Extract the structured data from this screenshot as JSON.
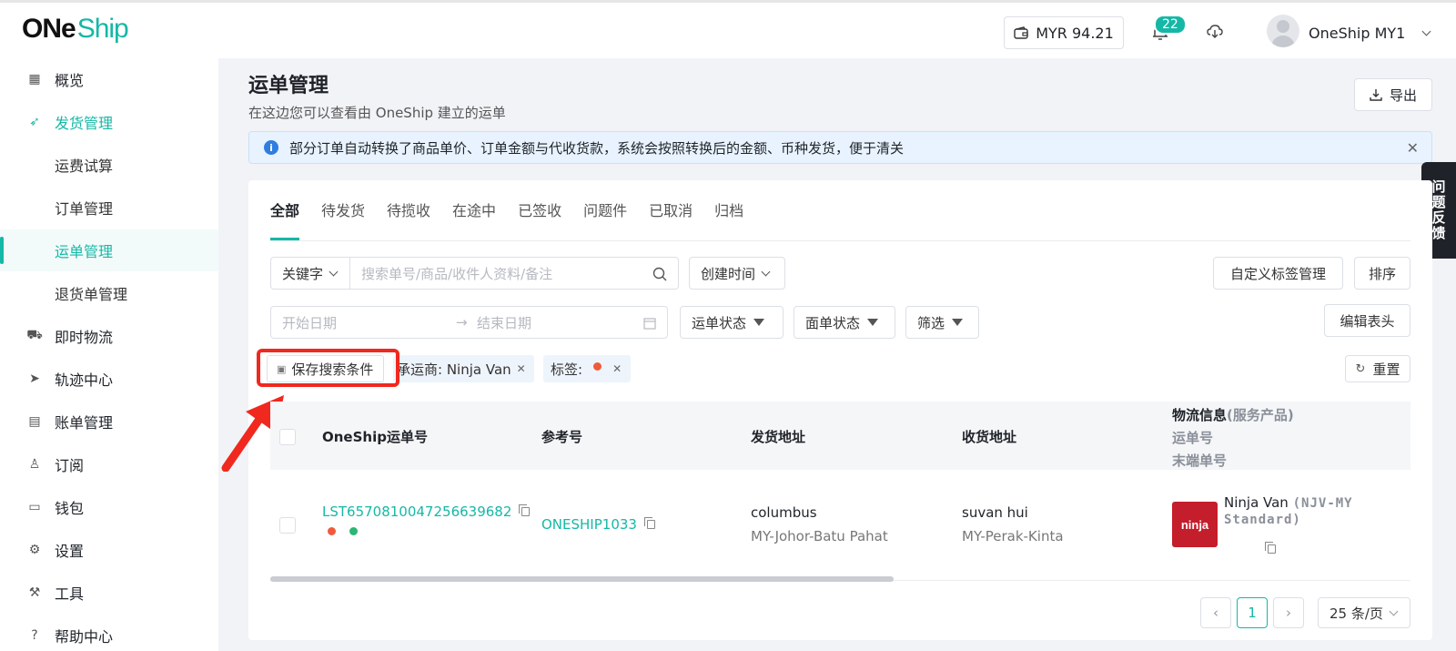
{
  "header": {
    "logo_one": "ONe",
    "logo_ship": "Ship",
    "wallet_balance": "MYR 94.21",
    "notification_count": "22",
    "user_name": "OneShip MY1"
  },
  "sidebar": {
    "items": [
      {
        "label": "概览",
        "icon": "grid-icon"
      },
      {
        "label": "发货管理",
        "icon": "rocket-icon"
      },
      {
        "label": "运费试算"
      },
      {
        "label": "订单管理"
      },
      {
        "label": "运单管理"
      },
      {
        "label": "退货单管理"
      },
      {
        "label": "即时物流",
        "icon": "scooter-icon"
      },
      {
        "label": "轨迹中心",
        "icon": "send-icon"
      },
      {
        "label": "账单管理",
        "icon": "document-icon"
      },
      {
        "label": "订阅",
        "icon": "user-icon"
      },
      {
        "label": "钱包",
        "icon": "wallet-icon"
      },
      {
        "label": "设置",
        "icon": "gear-icon"
      },
      {
        "label": "工具",
        "icon": "tool-icon"
      },
      {
        "label": "帮助中心",
        "icon": "help-icon"
      }
    ]
  },
  "page": {
    "title": "运单管理",
    "subtitle": "在这边您可以查看由 OneShip 建立的运单",
    "export_label": "导出",
    "notice": "部分订单自动转换了商品单价、订单金额与代收货款，系统会按照转换后的金额、币种发货，便于清关",
    "feedback": "问题反馈"
  },
  "tabs": [
    "全部",
    "待发货",
    "待揽收",
    "在途中",
    "已签收",
    "问题件",
    "已取消",
    "归档"
  ],
  "filters": {
    "keyword_select": "关键字",
    "search_placeholder": "搜索单号/商品/收件人资料/备注",
    "time_select": "创建时间",
    "custom_tag_btn": "自定义标签管理",
    "sort_btn": "排序",
    "start_date": "开始日期",
    "end_date": "结束日期",
    "waybill_status": "运单状态",
    "label_status": "面单状态",
    "filter": "筛选",
    "edit_header": "编辑表头",
    "save_search": "保存搜索条件",
    "carrier_tag": "承运商: Ninja Van",
    "label_tag": "标签:",
    "reset": "重置"
  },
  "table": {
    "columns": {
      "waybill": "OneShip运单号",
      "ref": "参考号",
      "from": "发货地址",
      "to": "收货地址",
      "logistics": "物流信息",
      "logistics_service": "(服务产品)",
      "logistics_no": "运单号",
      "last_mile": "末端单号"
    },
    "rows": [
      {
        "waybill": "LST6570810047256639682",
        "ref": "ONESHIP1033",
        "from_name": "columbus",
        "from_region": "MY-Johor-Batu Pahat",
        "to_name": "suvan hui",
        "to_region": "MY-Perak-Kinta",
        "carrier": "Ninja Van",
        "service": "(NJV-MY Standard)",
        "carrier_logo_text": "ninja"
      }
    ]
  },
  "pagination": {
    "current": "1",
    "page_size": "25 条/页"
  },
  "colors": {
    "accent": "#15b8a6",
    "highlight": "#f0281e",
    "tag_dot_red": "#f05a3c",
    "tag_dot_green": "#2bb673"
  }
}
